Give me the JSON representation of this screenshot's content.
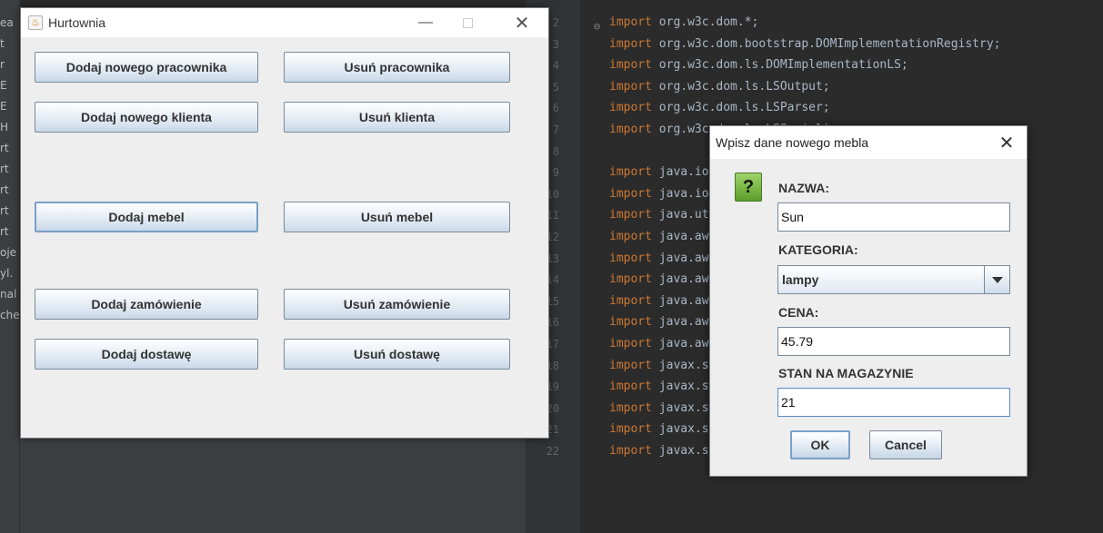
{
  "window": {
    "title": "Hurtownia",
    "buttons": [
      {
        "label": "Dodaj nowego pracownika",
        "name": "add-employee-button"
      },
      {
        "label": "Usuń pracownika",
        "name": "remove-employee-button"
      },
      {
        "label": "Dodaj nowego klienta",
        "name": "add-client-button"
      },
      {
        "label": "Usuń klienta",
        "name": "remove-client-button"
      },
      {
        "label": "Dodaj mebel",
        "name": "add-furniture-button"
      },
      {
        "label": "Usuń mebel",
        "name": "remove-furniture-button"
      },
      {
        "label": "Dodaj zamówienie",
        "name": "add-order-button"
      },
      {
        "label": "Usuń zamówienie",
        "name": "remove-order-button"
      },
      {
        "label": "Dodaj dostawę",
        "name": "add-delivery-button"
      },
      {
        "label": "Usuń dostawę",
        "name": "remove-delivery-button"
      }
    ]
  },
  "dialog": {
    "title": "Wpisz dane nowego mebla",
    "icon": "question-icon",
    "name_label": "NAZWA:",
    "name_value": "Sun",
    "category_label": "KATEGORIA:",
    "category_value": "lampy",
    "price_label": "CENA:",
    "price_value": "45.79",
    "stock_label": "STAN NA MAGAZYNIE",
    "stock_value": "21",
    "ok_label": "OK",
    "cancel_label": "Cancel"
  },
  "ide": {
    "left_panel": [
      "ea",
      "t",
      "r",
      "E",
      "E",
      "H",
      "rt",
      "rt",
      "rt",
      "rt",
      "rt",
      "oje",
      "yl.",
      "nal",
      "che"
    ],
    "lines": [
      {
        "num": "2",
        "kw": "import",
        "rest": " org.w3c.dom.*;"
      },
      {
        "num": "3",
        "kw": "import",
        "rest": " org.w3c.dom.bootstrap.DOMImplementationRegistry;"
      },
      {
        "num": "4",
        "kw": "import",
        "rest": " org.w3c.dom.ls.DOMImplementationLS;"
      },
      {
        "num": "5",
        "kw": "import",
        "rest": " org.w3c.dom.ls.LSOutput;"
      },
      {
        "num": "6",
        "kw": "import",
        "rest": " org.w3c.dom.ls.LSParser;"
      },
      {
        "num": "7",
        "kw": "import",
        "rest": " org.w3c.dom.ls.LSSerializer;"
      },
      {
        "num": "8",
        "kw": "",
        "rest": ""
      },
      {
        "num": "9",
        "kw": "import",
        "rest": " java.io.File;"
      },
      {
        "num": "10",
        "kw": "import",
        "rest": " java.io.IOException;"
      },
      {
        "num": "11",
        "kw": "import",
        "rest": " java.util.ArrayList;"
      },
      {
        "num": "12",
        "kw": "import",
        "rest": " java.awt.Color;"
      },
      {
        "num": "13",
        "kw": "import",
        "rest": " java.awt.BorderLayout;"
      },
      {
        "num": "14",
        "kw": "import",
        "rest": " java.awt.GridLayout;"
      },
      {
        "num": "15",
        "kw": "import",
        "rest": " java.awt.Font;"
      },
      {
        "num": "16",
        "kw": "import",
        "rest": " java.awt.event.ActionEvent;"
      },
      {
        "num": "17",
        "kw": "import",
        "rest": " java.awt.event.ActionListener;"
      },
      {
        "num": "18",
        "kw": "import",
        "rest": " javax.swing.JButton;"
      },
      {
        "num": "19",
        "kw": "import",
        "rest": " javax.swing.JFrame;"
      },
      {
        "num": "20",
        "kw": "import",
        "rest": " javax.swing.JOptionPane;"
      },
      {
        "num": "21",
        "kw": "import",
        "rest": " javax.swing.JPanel;"
      },
      {
        "num": "22",
        "kw": "import",
        "rest": " javax.swing.JTextField;"
      }
    ]
  }
}
